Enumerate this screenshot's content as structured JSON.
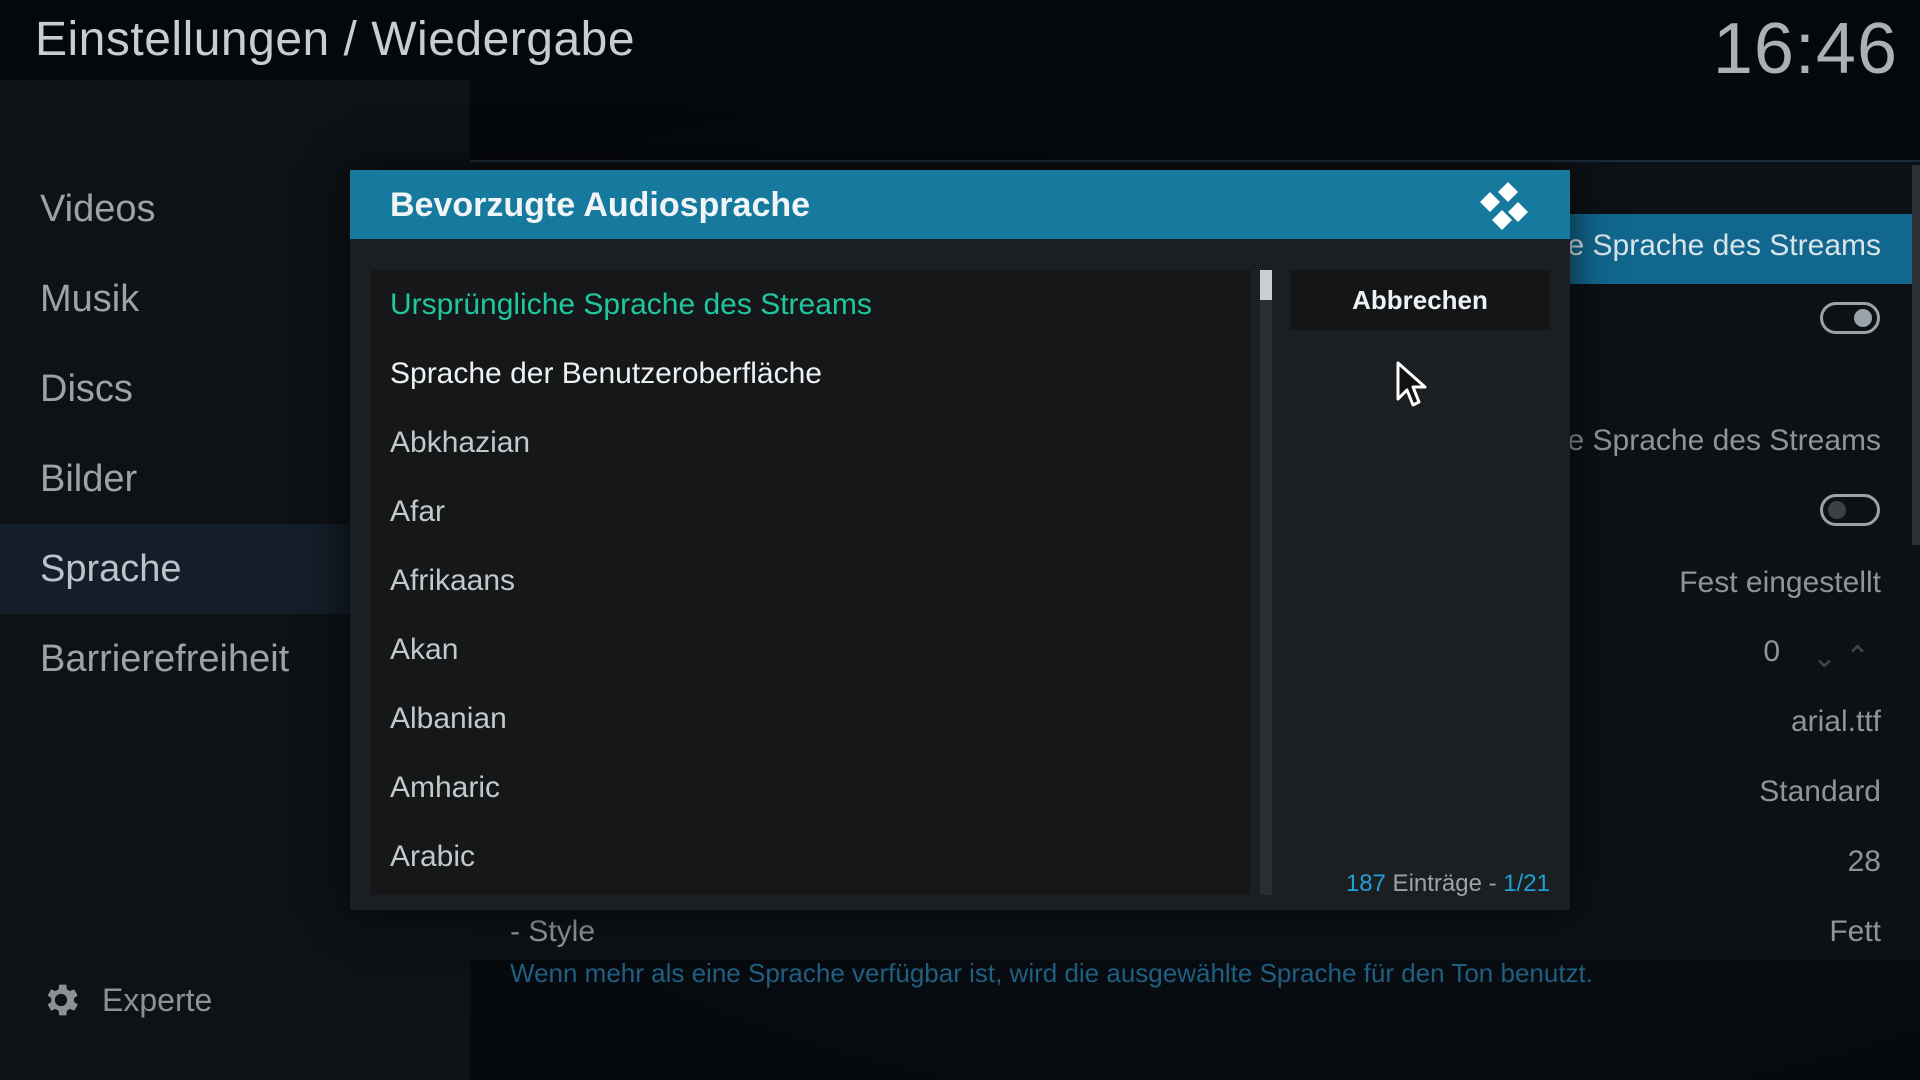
{
  "header": {
    "title": "Einstellungen / Wiedergabe",
    "clock": "16:46"
  },
  "sidebar": {
    "items": [
      {
        "label": "Videos"
      },
      {
        "label": "Musik"
      },
      {
        "label": "Discs"
      },
      {
        "label": "Bilder"
      },
      {
        "label": "Sprache"
      },
      {
        "label": "Barrierefreiheit"
      }
    ],
    "active_index": 4,
    "expert_label": "Experte",
    "expert_icon": "gear-icon"
  },
  "background_settings": {
    "values": {
      "audio_language": "he Sprache des Streams",
      "subtitle_language": "he Sprache des Streams",
      "position": "Fest eingestellt",
      "offset": "0",
      "font": "arial.ttf",
      "char_set": "Standard",
      "size": "28",
      "style_value": "Fett"
    },
    "style_label": "- Style",
    "description": "Wenn mehr als eine Sprache verfügbar ist, wird die ausgewählte Sprache für den Ton benutzt."
  },
  "dialog": {
    "title": "Bevorzugte Audiosprache",
    "cancel_label": "Abbrechen",
    "items": [
      "Ursprüngliche Sprache des Streams",
      "Sprache der Benutzeroberfläche",
      "Abkhazian",
      "Afar",
      "Afrikaans",
      "Akan",
      "Albanian",
      "Amharic",
      "Arabic"
    ],
    "count": {
      "total": "187",
      "label": " Einträge - ",
      "page": "1/21"
    }
  },
  "colors": {
    "accent": "#157a9e",
    "selected_text": "#1fc7a0",
    "count_number": "#1f9fd6"
  }
}
